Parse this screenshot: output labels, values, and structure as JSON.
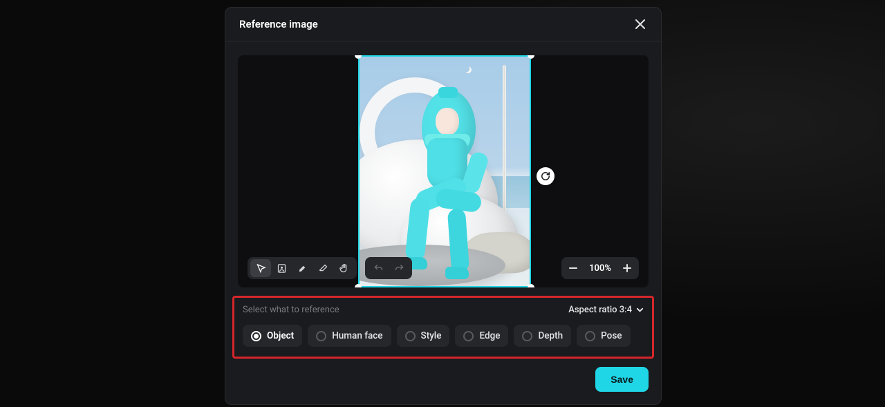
{
  "modal": {
    "title": "Reference image"
  },
  "zoom": {
    "level": "100%"
  },
  "tools": {
    "cursor": "cursor",
    "portrait": "portrait-select",
    "brush": "brush",
    "eraser": "eraser",
    "hand": "pan-hand",
    "undo": "undo",
    "redo": "redo"
  },
  "reference": {
    "instruction": "Select what to reference",
    "aspect_label": "Aspect ratio 3:4",
    "options": [
      {
        "label": "Object",
        "selected": true
      },
      {
        "label": "Human face",
        "selected": false
      },
      {
        "label": "Style",
        "selected": false
      },
      {
        "label": "Edge",
        "selected": false
      },
      {
        "label": "Depth",
        "selected": false
      },
      {
        "label": "Pose",
        "selected": false
      }
    ]
  },
  "footer": {
    "save_label": "Save"
  }
}
